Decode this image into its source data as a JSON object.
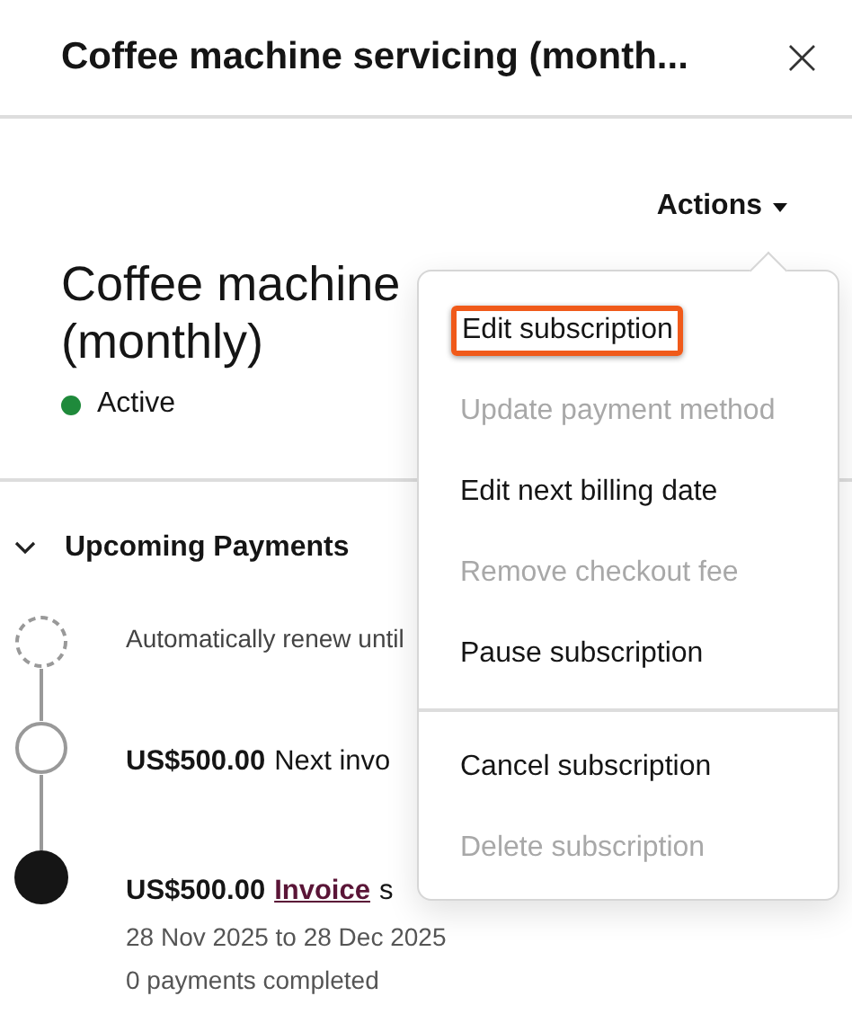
{
  "panel": {
    "title": "Coffee machine servicing (month...",
    "close": "×"
  },
  "actions": {
    "label": "Actions",
    "expanded": true
  },
  "subscription": {
    "name_lines": [
      "Coffee machine",
      "(monthly)"
    ],
    "status": {
      "label": "Active",
      "color": "#1f8a3b"
    }
  },
  "section": {
    "title": "Upcoming Payments",
    "expanded": true
  },
  "timeline": [
    {
      "kind": "renewal",
      "text": "Automatically renew until"
    },
    {
      "kind": "upcoming",
      "amount": "US$500.00",
      "text": "Next invo"
    },
    {
      "kind": "current",
      "amount": "US$500.00",
      "link": "Invoice",
      "text": "s",
      "details": [
        "28 Nov 2025 to 28 Dec 2025",
        "0 payments completed"
      ]
    }
  ],
  "menu_sections": [
    {
      "items": [
        {
          "label": "Edit subscription",
          "disabled": false,
          "highlighted": true
        },
        {
          "label": "Update payment method",
          "disabled": true,
          "highlighted": false
        },
        {
          "label": "Edit next billing date",
          "disabled": false,
          "highlighted": false
        },
        {
          "label": "Remove checkout fee",
          "disabled": true,
          "highlighted": false
        },
        {
          "label": "Pause subscription",
          "disabled": false,
          "highlighted": false
        }
      ]
    },
    {
      "items": [
        {
          "label": "Cancel subscription",
          "disabled": false,
          "highlighted": false
        },
        {
          "label": "Delete subscription",
          "disabled": true,
          "highlighted": false
        }
      ]
    }
  ]
}
